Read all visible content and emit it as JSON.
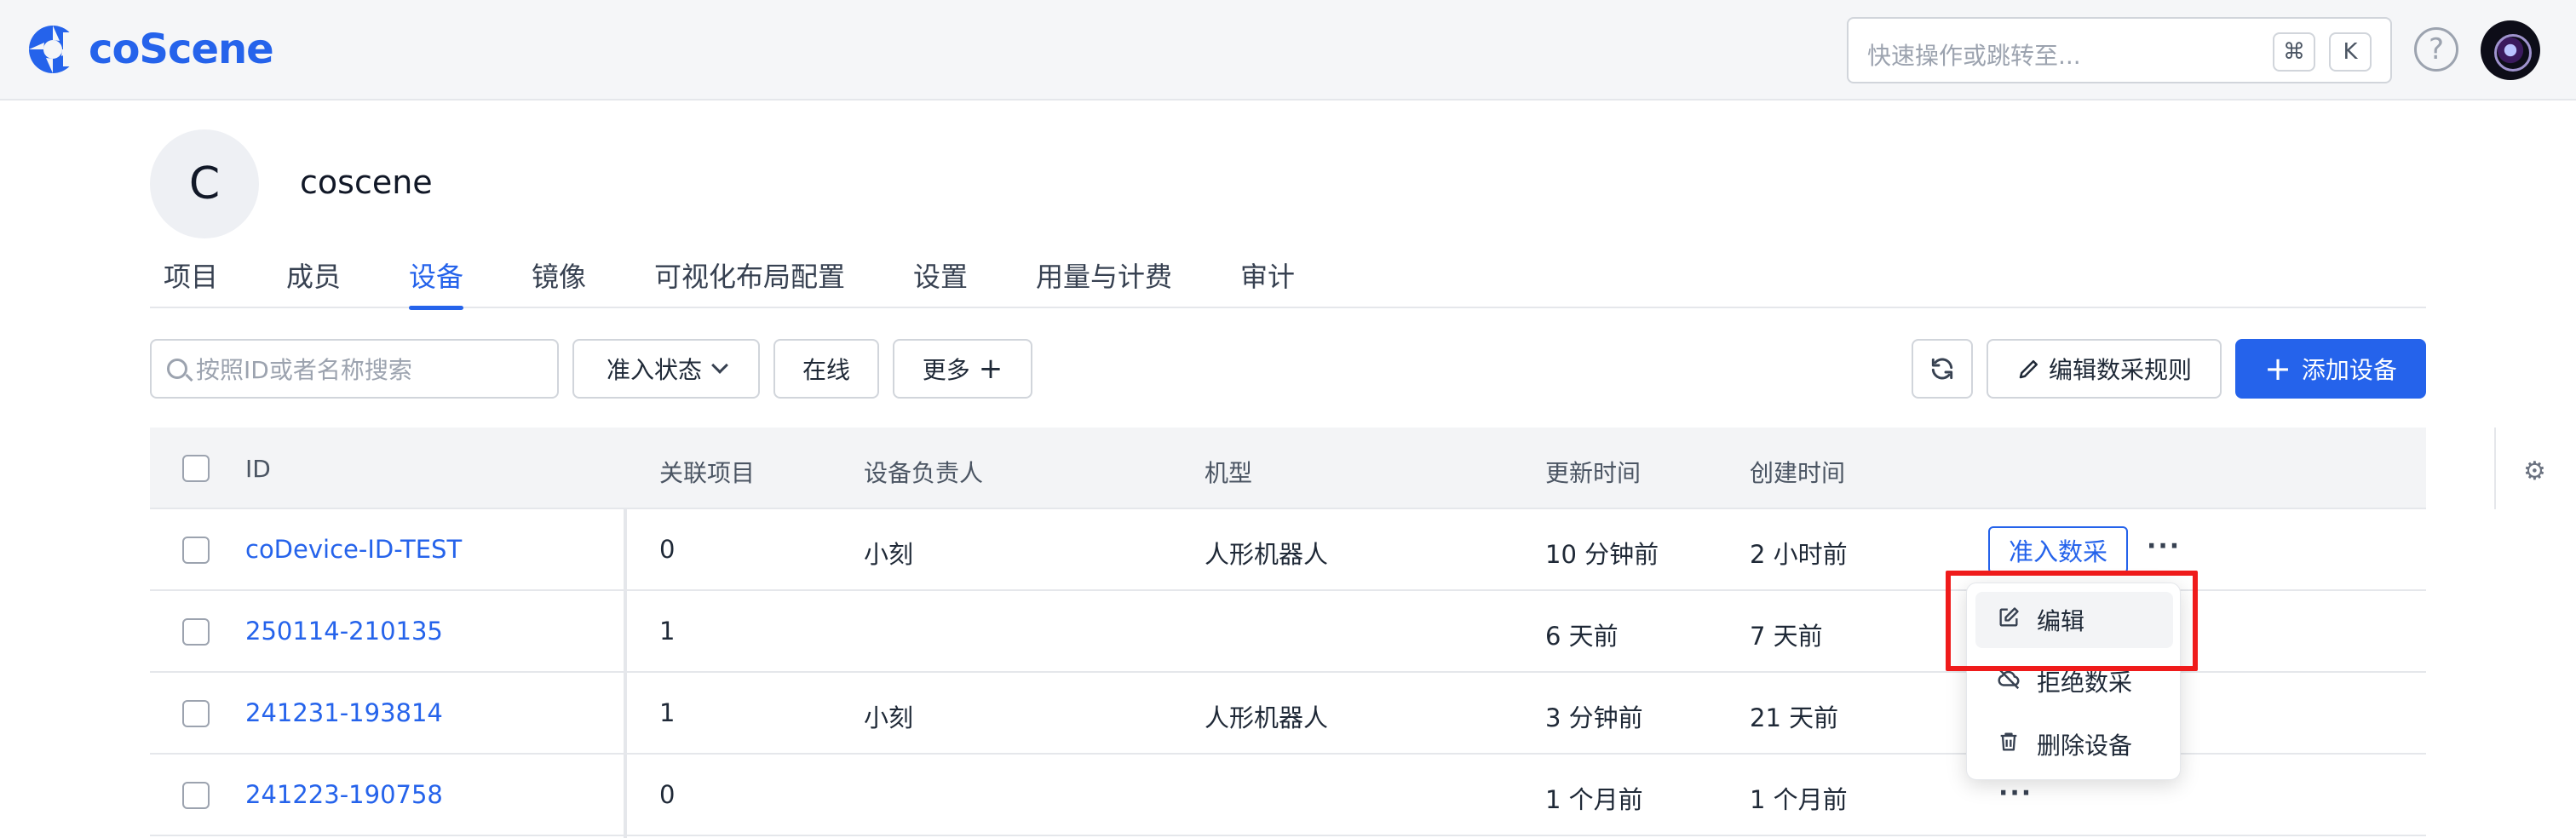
{
  "header": {
    "brand": "coScene",
    "search_placeholder": "快速操作或跳转至...",
    "shortcut_cmd": "⌘",
    "shortcut_key": "K",
    "help_symbol": "?"
  },
  "org": {
    "initial": "C",
    "name": "coscene"
  },
  "tabs": [
    {
      "label": "项目"
    },
    {
      "label": "成员"
    },
    {
      "label": "设备",
      "active": true
    },
    {
      "label": "镜像"
    },
    {
      "label": "可视化布局配置"
    },
    {
      "label": "设置"
    },
    {
      "label": "用量与计费"
    },
    {
      "label": "审计"
    }
  ],
  "toolbar": {
    "search_placeholder": "按照ID或者名称搜索",
    "status_filter": "准入状态",
    "online_filter": "在线",
    "more_filter": "更多",
    "edit_rules": "编辑数采规则",
    "add_device": "添加设备"
  },
  "table": {
    "headers": {
      "id": "ID",
      "projects": "关联项目",
      "owner": "设备负责人",
      "model": "机型",
      "updated": "更新时间",
      "created": "创建时间"
    },
    "rows": [
      {
        "id": "coDevice-ID-TEST",
        "projects": "0",
        "owner": "小刻",
        "model": "人形机器人",
        "updated": "10 分钟前",
        "created": "2 小时前",
        "action": "准入数采"
      },
      {
        "id": "250114-210135",
        "projects": "1",
        "owner": "",
        "model": "",
        "updated": "6 天前",
        "created": "7 天前"
      },
      {
        "id": "241231-193814",
        "projects": "1",
        "owner": "小刻",
        "model": "人形机器人",
        "updated": "3 分钟前",
        "created": "21 天前"
      },
      {
        "id": "241223-190758",
        "projects": "0",
        "owner": "",
        "model": "",
        "updated": "1 个月前",
        "created": "1 个月前"
      }
    ]
  },
  "menu": {
    "items": [
      {
        "label": "编辑",
        "icon": "edit-icon"
      },
      {
        "label": "拒绝数采",
        "icon": "cloud-off-icon"
      },
      {
        "label": "删除设备",
        "icon": "trash-icon"
      }
    ]
  },
  "colors": {
    "accent": "#2563eb",
    "highlight": "#ef1b1b"
  }
}
